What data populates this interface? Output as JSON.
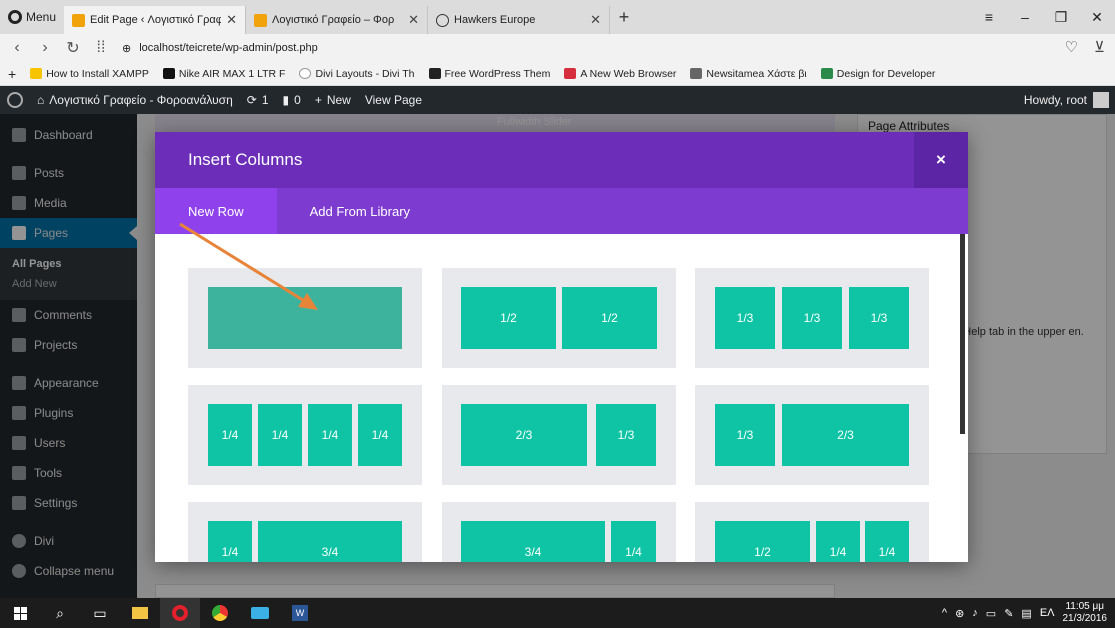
{
  "browser": {
    "menu_label": "Menu",
    "tabs": [
      {
        "label": "Edit Page ‹ Λογιστικό Γραφ",
        "active": true
      },
      {
        "label": "Λογιστικό Γραφείο – Φορ",
        "active": false
      },
      {
        "label": "Hawkers Europe",
        "active": false
      }
    ],
    "url": "localhost/teicrete/wp-admin/post.php",
    "bookmarks": [
      "How to Install XAMPP",
      "Nike AIR MAX 1 LTR F",
      "Divi Layouts - Divi Th",
      "Free WordPress Them",
      "A New Web Browser",
      "Newsitamea Χάστε βι",
      "Design for Developer"
    ]
  },
  "wpbar": {
    "site_name": "Λογιστικό Γραφείο - Φοροανάλυση",
    "updates": "1",
    "comments": "0",
    "new_label": "New",
    "view_page": "View Page",
    "howdy": "Howdy, root"
  },
  "sidebar": {
    "items": [
      {
        "label": "Dashboard",
        "icon": "dashboard-icon"
      },
      {
        "label": "Posts",
        "icon": "pin-icon"
      },
      {
        "label": "Media",
        "icon": "media-icon"
      },
      {
        "label": "Pages",
        "icon": "page-icon",
        "active": true
      },
      {
        "label": "Comments",
        "icon": "comment-icon"
      },
      {
        "label": "Projects",
        "icon": "pin-icon"
      },
      {
        "label": "Appearance",
        "icon": "brush-icon"
      },
      {
        "label": "Plugins",
        "icon": "plug-icon"
      },
      {
        "label": "Users",
        "icon": "user-icon"
      },
      {
        "label": "Tools",
        "icon": "wrench-icon"
      },
      {
        "label": "Settings",
        "icon": "settings-icon"
      },
      {
        "label": "Divi",
        "icon": "divi-icon"
      },
      {
        "label": "Collapse menu",
        "icon": "collapse-icon"
      }
    ],
    "submenu": [
      "All Pages",
      "Add New"
    ]
  },
  "background": {
    "builder_title": "Fullwidth Slider",
    "panel_title": "Page Attributes",
    "help_text": "he Help tab in the upper en."
  },
  "modal": {
    "title": "Insert Columns",
    "close": "×",
    "tabs": [
      "New Row",
      "Add From Library"
    ],
    "layouts": [
      {
        "cols": [
          ""
        ]
      },
      {
        "cols": [
          "1/2",
          "1/2"
        ]
      },
      {
        "cols": [
          "1/3",
          "1/3",
          "1/3"
        ]
      },
      {
        "cols": [
          "1/4",
          "1/4",
          "1/4",
          "1/4"
        ]
      },
      {
        "cols": [
          "2/3",
          "1/3"
        ]
      },
      {
        "cols": [
          "1/3",
          "2/3"
        ]
      },
      {
        "cols": [
          "1/4",
          "3/4"
        ]
      },
      {
        "cols": [
          "3/4",
          "1/4"
        ]
      },
      {
        "cols": [
          "1/2",
          "1/4",
          "1/4"
        ]
      }
    ]
  },
  "taskbar": {
    "lang": "ΕΛ",
    "time": "11:05 μμ",
    "date": "21/3/2016"
  },
  "colors": {
    "modal_header": "#6c2eb9",
    "modal_tabs": "#7e3bd0",
    "column_green": "#0fc4a5",
    "arrow": "#e8843a",
    "wp_dark": "#23282d",
    "wp_blue": "#0073aa"
  }
}
